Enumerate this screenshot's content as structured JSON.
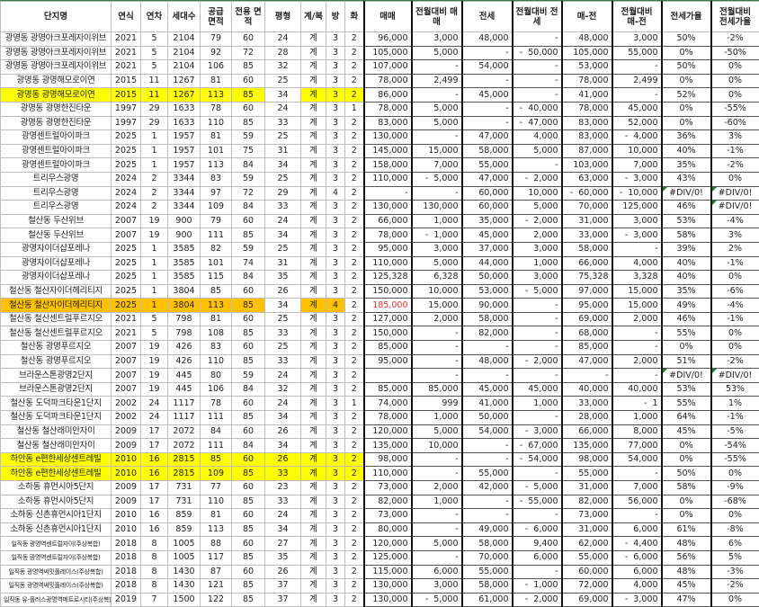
{
  "headers": [
    "단지명",
    "연식",
    "연차",
    "세대수",
    "공급 면적",
    "전용 면적",
    "평형",
    "계/복",
    "방",
    "화",
    "매매",
    "전월대비 매매",
    "전세",
    "전월대비 전세",
    "매-전",
    "전월대비 매-전",
    "전세가율",
    "전월대비 전세가율"
  ],
  "colors": {
    "yellow": "#ffff00",
    "orange": "#ffc000",
    "red_text": "#e03030"
  },
  "rows": [
    {
      "cells": [
        "광명동 광명아크포레자이위브",
        "2021",
        "5",
        "2104",
        "79",
        "60",
        "24",
        "계",
        "3",
        "2",
        "96,000",
        "3,000",
        "48,000",
        "-",
        "48,000",
        "3,000",
        "50%",
        "-2%"
      ]
    },
    {
      "cells": [
        "광명동 광명아크포레자이위브",
        "2021",
        "5",
        "2104",
        "92",
        "72",
        "28",
        "계",
        "3",
        "2",
        "105,000",
        "5,000",
        "-",
        "-  50,000",
        "105,000",
        "55,000",
        "0%",
        "-50%"
      ]
    },
    {
      "cells": [
        "광명동 광명아크포레자이위브",
        "2021",
        "5",
        "2104",
        "106",
        "85",
        "32",
        "계",
        "3",
        "2",
        "107,000",
        "-",
        "54,000",
        "-",
        "53,000",
        "-",
        "50%",
        "0%"
      ]
    },
    {
      "cells": [
        "광명동 광명해모로이연",
        "2015",
        "11",
        "1267",
        "81",
        "60",
        "25",
        "계",
        "3",
        "2",
        "78,000",
        "2,499",
        "-",
        "-",
        "78,000",
        "2,499",
        "0%",
        "0%"
      ]
    },
    {
      "cells": [
        "광명동 광명해모로이연",
        "2015",
        "11",
        "1267",
        "113",
        "85",
        "34",
        "계",
        "3",
        "2",
        "86,000",
        "-",
        "45,000",
        "-",
        "41,000",
        "-",
        "52%",
        "0%"
      ],
      "highlight": "yellow",
      "skip": [
        6
      ]
    },
    {
      "cells": [
        "광명동 광명한진타운",
        "1997",
        "29",
        "1633",
        "78",
        "60",
        "24",
        "계",
        "3",
        "1",
        "78,000",
        "5,000",
        "-",
        "-  40,000",
        "78,000",
        "45,000",
        "0%",
        "-55%"
      ]
    },
    {
      "cells": [
        "광명동 광명한진타운",
        "1997",
        "29",
        "1633",
        "110",
        "85",
        "33",
        "계",
        "3",
        "2",
        "83,000",
        "5,000",
        "-",
        "-  47,000",
        "83,000",
        "52,000",
        "0%",
        "-60%"
      ]
    },
    {
      "cells": [
        "광명센트럴아이파크",
        "2025",
        "1",
        "1957",
        "81",
        "59",
        "25",
        "계",
        "3",
        "2",
        "130,000",
        "-",
        "47,000",
        "4,000",
        "83,000",
        "-  4,000",
        "36%",
        "3%"
      ]
    },
    {
      "cells": [
        "광명센트럴아이파크",
        "2025",
        "1",
        "1957",
        "101",
        "75",
        "31",
        "계",
        "3",
        "2",
        "145,000",
        "15,000",
        "58,000",
        "5,000",
        "87,000",
        "10,000",
        "40%",
        "-1%"
      ]
    },
    {
      "cells": [
        "광명센트럴아이파크",
        "2025",
        "1",
        "1957",
        "113",
        "84",
        "34",
        "계",
        "3",
        "2",
        "158,000",
        "7,000",
        "55,000",
        "-",
        "103,000",
        "7,000",
        "35%",
        "-2%"
      ]
    },
    {
      "cells": [
        "트리우스광명",
        "2024",
        "2",
        "3344",
        "83",
        "59",
        "25",
        "계",
        "3",
        "2",
        "110,000",
        "-  5,000",
        "47,000",
        "-  2,000",
        "63,000",
        "-  3,000",
        "43%",
        "0%"
      ]
    },
    {
      "cells": [
        "트리우스광명",
        "2024",
        "2",
        "3344",
        "97",
        "72",
        "29",
        "계",
        "4",
        "2",
        "-",
        "-",
        "60,000",
        "10,000",
        "-  60,000",
        "-  10,000",
        "#DIV/0!",
        "#DIV/0!"
      ]
    },
    {
      "cells": [
        "트리우스광명",
        "2024",
        "2",
        "3344",
        "109",
        "84",
        "33",
        "계",
        "3",
        "2",
        "130,000",
        "130,000",
        "60,000",
        "5,000",
        "70,000",
        "125,000",
        "46%",
        "#DIV/0!"
      ]
    },
    {
      "cells": [
        "철산동 두산위브",
        "2007",
        "19",
        "900",
        "79",
        "60",
        "24",
        "계",
        "3",
        "2",
        "66,000",
        "1,000",
        "35,000",
        "-  2,000",
        "31,000",
        "3,000",
        "53%",
        "-4%"
      ]
    },
    {
      "cells": [
        "철산동 두산위브",
        "2007",
        "19",
        "900",
        "111",
        "85",
        "34",
        "계",
        "3",
        "2",
        "78,000",
        "-  1,000",
        "45,000",
        "2,000",
        "33,000",
        "-  3,000",
        "58%",
        "3%"
      ]
    },
    {
      "cells": [
        "광명자이더샵포레나",
        "2025",
        "1",
        "3585",
        "82",
        "59",
        "25",
        "계",
        "3",
        "2",
        "95,000",
        "3,000",
        "37,000",
        "3,000",
        "58,000",
        "-",
        "39%",
        "2%"
      ]
    },
    {
      "cells": [
        "광명자이더샵포레나",
        "2025",
        "1",
        "3585",
        "101",
        "74",
        "31",
        "계",
        "3",
        "2",
        "110,000",
        "5,000",
        "44,000",
        "1,000",
        "66,000",
        "4,000",
        "40%",
        "-1%"
      ]
    },
    {
      "cells": [
        "광명자이더샵포레나",
        "2025",
        "1",
        "3585",
        "115",
        "84",
        "35",
        "계",
        "3",
        "2",
        "125,328",
        "6,328",
        "50,000",
        "3,000",
        "75,328",
        "3,328",
        "40%",
        "0%"
      ]
    },
    {
      "cells": [
        "철산동 철산자이더헤리티지",
        "2025",
        "1",
        "3804",
        "85",
        "60",
        "26",
        "계",
        "3",
        "2",
        "150,000",
        "10,000",
        "53,000",
        "-  5,000",
        "97,000",
        "15,000",
        "35%",
        "-6%"
      ]
    },
    {
      "cells": [
        "철산동 철산자이더헤리티지",
        "2025",
        "1",
        "3804",
        "113",
        "85",
        "34",
        "계",
        "4",
        "2",
        "185,000",
        "15,000",
        "90,000",
        "-",
        "95,000",
        "15,000",
        "49%",
        "-4%"
      ],
      "highlight": "orange",
      "skip": [
        6,
        9
      ],
      "red": [
        10
      ]
    },
    {
      "cells": [
        "철산동 철산센트럴푸르지오",
        "2021",
        "5",
        "798",
        "81",
        "60",
        "25",
        "계",
        "3",
        "2",
        "127,000",
        "2,000",
        "58,000",
        "-",
        "69,000",
        "2,000",
        "46%",
        "-1%"
      ]
    },
    {
      "cells": [
        "철산동 철산센트럴푸르지오",
        "2021",
        "5",
        "798",
        "108",
        "85",
        "33",
        "계",
        "3",
        "2",
        "150,000",
        "-",
        "82,000",
        "-",
        "68,000",
        "-",
        "55%",
        "0%"
      ]
    },
    {
      "cells": [
        "철산동 광명푸르지오",
        "2007",
        "19",
        "426",
        "83",
        "60",
        "25",
        "계",
        "3",
        "2",
        "85,000",
        "-",
        "-",
        "-",
        "85,000",
        "-",
        "0%",
        "0%"
      ]
    },
    {
      "cells": [
        "철산동 광명푸르지오",
        "2007",
        "19",
        "426",
        "110",
        "85",
        "33",
        "계",
        "3",
        "2",
        "95,000",
        "-",
        "48,000",
        "-  2,000",
        "47,000",
        "2,000",
        "51%",
        "-2%"
      ]
    },
    {
      "cells": [
        "브라운스톤광명2단지",
        "2007",
        "19",
        "445",
        "80",
        "59",
        "24",
        "계",
        "3",
        "2",
        "",
        "-",
        "-",
        "-",
        "-",
        "-",
        "#DIV/0!",
        "#DIV/0!"
      ]
    },
    {
      "cells": [
        "브라운스톤광명2단지",
        "2007",
        "19",
        "445",
        "106",
        "84",
        "32",
        "계",
        "3",
        "2",
        "85,000",
        "85,000",
        "45,000",
        "45,000",
        "40,000",
        "40,000",
        "53%",
        "53%"
      ]
    },
    {
      "cells": [
        "철산동 도덕파크타운1단지",
        "2002",
        "24",
        "1117",
        "78",
        "60",
        "24",
        "계",
        "3",
        "1",
        "74,000",
        "999",
        "41,000",
        "1,000",
        "33,000",
        "-  1",
        "55%",
        "1%"
      ]
    },
    {
      "cells": [
        "철산동 도덕파크타운1단지",
        "2002",
        "24",
        "1117",
        "111",
        "85",
        "34",
        "계",
        "3",
        "2",
        "78,000",
        "1,000",
        "50,000",
        "-",
        "28,000",
        "1,000",
        "64%",
        "-1%"
      ]
    },
    {
      "cells": [
        "철산동 철산래미안자이",
        "2009",
        "17",
        "2072",
        "84",
        "60",
        "26",
        "계",
        "3",
        "2",
        "120,000",
        "5,000",
        "54,000",
        "-  3,000",
        "66,000",
        "8,000",
        "45%",
        "-5%"
      ]
    },
    {
      "cells": [
        "철산동 철산래미안자이",
        "2009",
        "17",
        "2072",
        "111",
        "84",
        "34",
        "계",
        "3",
        "2",
        "135,000",
        "10,000",
        "-",
        "-  67,000",
        "135,000",
        "77,000",
        "0%",
        "-54%"
      ]
    },
    {
      "cells": [
        "하안동 e편한세상센트레빌",
        "2010",
        "16",
        "2815",
        "85",
        "60",
        "26",
        "계",
        "3",
        "2",
        "98,000",
        "-",
        "-",
        "-  54,000",
        "98,000",
        "54,000",
        "0%",
        "-55%"
      ],
      "highlight": "yellow"
    },
    {
      "cells": [
        "하안동 e편한세상센트레빌",
        "2010",
        "16",
        "2815",
        "109",
        "85",
        "33",
        "계",
        "3",
        "2",
        "110,000",
        "-",
        "55,000",
        "-",
        "55,000",
        "-",
        "50%",
        "0%"
      ],
      "highlight": "yellow"
    },
    {
      "cells": [
        "소하동 휴먼시아5단지",
        "2009",
        "17",
        "731",
        "77",
        "60",
        "23",
        "계",
        "3",
        "2",
        "73,000",
        "2,000",
        "42,000",
        "-  5,000",
        "31,000",
        "7,000",
        "58%",
        "-9%"
      ]
    },
    {
      "cells": [
        "소하동 휴먼시아5단지",
        "2009",
        "17",
        "731",
        "110",
        "85",
        "33",
        "계",
        "3",
        "2",
        "82,000",
        "1,000",
        "-",
        "-  55,000",
        "82,000",
        "56,000",
        "0%",
        "-68%"
      ]
    },
    {
      "cells": [
        "소하동 신촌휴먼시아1단지",
        "2010",
        "16",
        "859",
        "81",
        "60",
        "24",
        "계",
        "3",
        "2",
        "73,000",
        "-",
        "-",
        "-",
        "73,000",
        "-",
        "0%",
        "0%"
      ]
    },
    {
      "cells": [
        "소하동 신촌휴먼시아1단지",
        "2010",
        "16",
        "859",
        "113",
        "85",
        "34",
        "계",
        "3",
        "2",
        "80,000",
        "-",
        "49,000",
        "-  6,000",
        "31,000",
        "6,000",
        "61%",
        "-8%"
      ]
    },
    {
      "cells": [
        "일직동 광명역센트럴자이(주상복합)",
        "2018",
        "8",
        "1005",
        "88",
        "60",
        "27",
        "계",
        "3",
        "2",
        "120,000",
        "5,000",
        "58,000",
        "9,400",
        "62,000",
        "-  4,400",
        "48%",
        "6%"
      ]
    },
    {
      "cells": [
        "일직동 광명역센트럴자이(주상복합)",
        "2018",
        "8",
        "1005",
        "117",
        "85",
        "35",
        "계",
        "3",
        "2",
        "125,000",
        "-",
        "70,000",
        "6,000",
        "55,000",
        "-  6,000",
        "56%",
        "5%"
      ]
    },
    {
      "cells": [
        "일직동 광명역써밋플레이스(주상복합)",
        "2018",
        "8",
        "1430",
        "87",
        "60",
        "26",
        "계",
        "3",
        "2",
        "115,000",
        "6,000",
        "55,000",
        "-",
        "60,000",
        "6,000",
        "48%",
        "-3%"
      ]
    },
    {
      "cells": [
        "일직동 광명역써밋플레이스(주상복합)",
        "2018",
        "8",
        "1430",
        "121",
        "85",
        "37",
        "계",
        "3",
        "2",
        "130,000",
        "3,000",
        "58,000",
        "-  1,000",
        "72,000",
        "4,000",
        "45%",
        "-2%"
      ]
    },
    {
      "cells": [
        "일직동 유-플러스광명역메트로시티(주상복합)",
        "2019",
        "7",
        "1500",
        "122",
        "85",
        "37",
        "계",
        "3",
        "2",
        "130,000",
        "-  5,000",
        "61,000",
        "-  2,000",
        "69,000",
        "-  3,000",
        "47%",
        "0%"
      ]
    }
  ]
}
